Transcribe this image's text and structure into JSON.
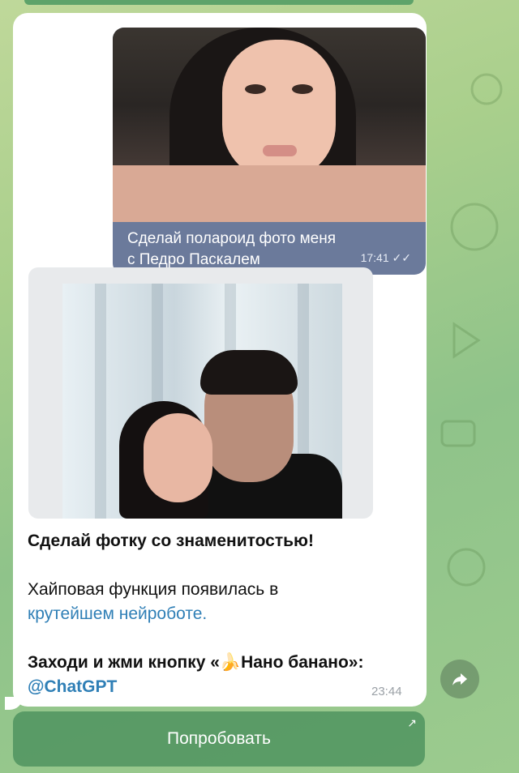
{
  "outgoing_message": {
    "caption_line1": "Сделай полароид фото меня",
    "caption_line2": "с Педро Паскалем",
    "time": "17:41"
  },
  "incoming_message": {
    "title": "Сделай фотку со знаменитостью!",
    "line1": "Хайповая функция появилась в",
    "link1": "крутейшем нейроботе.",
    "cta": "Заходи и жми кнопку «🍌Нано банано»:",
    "link2": "@ChatGPT",
    "time": "23:44"
  },
  "inline_button": {
    "label": "Попробовать"
  },
  "colors": {
    "accent": "#2f7fb6",
    "outgoing_bubble": "#6b7a9b"
  }
}
